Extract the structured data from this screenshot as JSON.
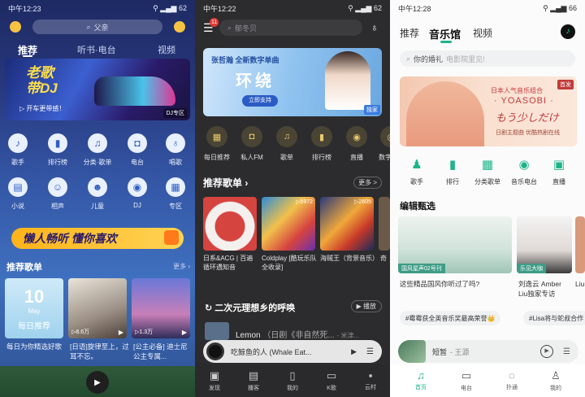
{
  "panel1": {
    "status": {
      "time": "中午12:23",
      "right": "62"
    },
    "search_placeholder": "父亲",
    "tabs": [
      "推荐",
      "听书·电台",
      "视频"
    ],
    "banner": {
      "title_line1": "老歌",
      "title_line2": "带DJ",
      "subtitle": "开车更带感！",
      "tag": "DJ专区"
    },
    "icons": [
      {
        "icon": "singer-icon",
        "label": "歌手"
      },
      {
        "icon": "chart-icon",
        "label": "排行榜"
      },
      {
        "icon": "playlist-icon",
        "label": "分类·歌单"
      },
      {
        "icon": "radio-icon",
        "label": "电台"
      },
      {
        "icon": "mic-icon",
        "label": "唱歌"
      },
      {
        "icon": "book-icon",
        "label": "小说"
      },
      {
        "icon": "mask-icon",
        "label": "相声"
      },
      {
        "icon": "kid-icon",
        "label": "儿童"
      },
      {
        "icon": "disc-icon",
        "label": "DJ"
      },
      {
        "icon": "grid-icon",
        "label": "专区"
      }
    ],
    "ad_text": "懒人畅听 懂你喜欢",
    "section_title": "推荐歌单",
    "section_more": "更多",
    "cards": [
      {
        "badge": "10",
        "month": "May",
        "label": "每日推荐",
        "caption": "每日为你精选好歌"
      },
      {
        "plays": "8.6万",
        "caption": "[日语]旋律至上，过耳不忘。"
      },
      {
        "plays": "1.3万",
        "caption": "[公主必备] 迪士尼公主专属..."
      }
    ]
  },
  "panel2": {
    "status": {
      "time": "中午12:22",
      "right": "62"
    },
    "notif_count": "11",
    "search_placeholder": "郁冬贝",
    "banner": {
      "line1": "张哲瀚 全新数字单曲",
      "title": "环绕",
      "button": "立即支持",
      "tag": "独家"
    },
    "icons": [
      {
        "icon": "calendar-icon",
        "label": "每日推荐"
      },
      {
        "icon": "radio-icon",
        "label": "私人FM"
      },
      {
        "icon": "playlist-icon",
        "label": "歌单"
      },
      {
        "icon": "chart-icon",
        "label": "排行榜"
      },
      {
        "icon": "live-icon",
        "label": "直播"
      },
      {
        "icon": "album-icon",
        "label": "数字"
      }
    ],
    "section_title": "推荐歌单",
    "section_more": "更多 >",
    "cards": [
      {
        "plays": "",
        "caption": "日系&ACG | 百遍循环遇知音"
      },
      {
        "plays": "5972",
        "caption": "Coldplay [酷玩乐队全收录]"
      },
      {
        "plays": "2605",
        "caption": "海贼王（背景音乐）"
      },
      {
        "plays": "",
        "caption": "奇"
      }
    ],
    "section2_title": "二次元理想乡的呼唤",
    "section2_play": "▶ 播放",
    "song": {
      "title": "Lemon",
      "detail": "（日剧《非自然死...",
      "artist": "- 米津..."
    },
    "mini_player": {
      "title": "吃鲸鱼的人 (Whale Eat..."
    },
    "nav": [
      "发现",
      "播客",
      "我的",
      "K歌",
      "云村"
    ]
  },
  "panel3": {
    "status": {
      "time": "中午12:28",
      "right": "66"
    },
    "tabs": [
      "推荐",
      "音乐馆",
      "视频"
    ],
    "search_placeholder": "你的婚礼",
    "search_hint": "电影院里见!",
    "banner": {
      "line1": "日本人气音乐组合",
      "line2": "YOASOBI",
      "line3": "もう少しだけ",
      "line4": "日剧主题曲 优酷热剧在线",
      "tag": "首发"
    },
    "icons": [
      {
        "icon": "singer-icon",
        "label": "歌手"
      },
      {
        "icon": "chart-icon",
        "label": "排行"
      },
      {
        "icon": "playlist-icon",
        "label": "分类歌单"
      },
      {
        "icon": "broadcast-icon",
        "label": "音乐电台"
      },
      {
        "icon": "live-icon",
        "label": "直播"
      }
    ],
    "section_title": "编辑甄选",
    "cards": [
      {
        "tag": "国风星声02号刊",
        "caption": "这些精品国风你听过了吗?"
      },
      {
        "tag": "乐见大咖",
        "caption": "刘逸云 Amber Liu独家专访"
      },
      {
        "tag": "",
        "caption": "Liu"
      }
    ],
    "chips": [
      "#霉霉获全英音乐奖最高荣誉👑",
      "#Lisa将与蛇叔合作"
    ],
    "mini_player": {
      "title": "短暂",
      "artist": "- 王源"
    },
    "nav": [
      "首页",
      "电台",
      "扑通",
      "我的"
    ]
  }
}
